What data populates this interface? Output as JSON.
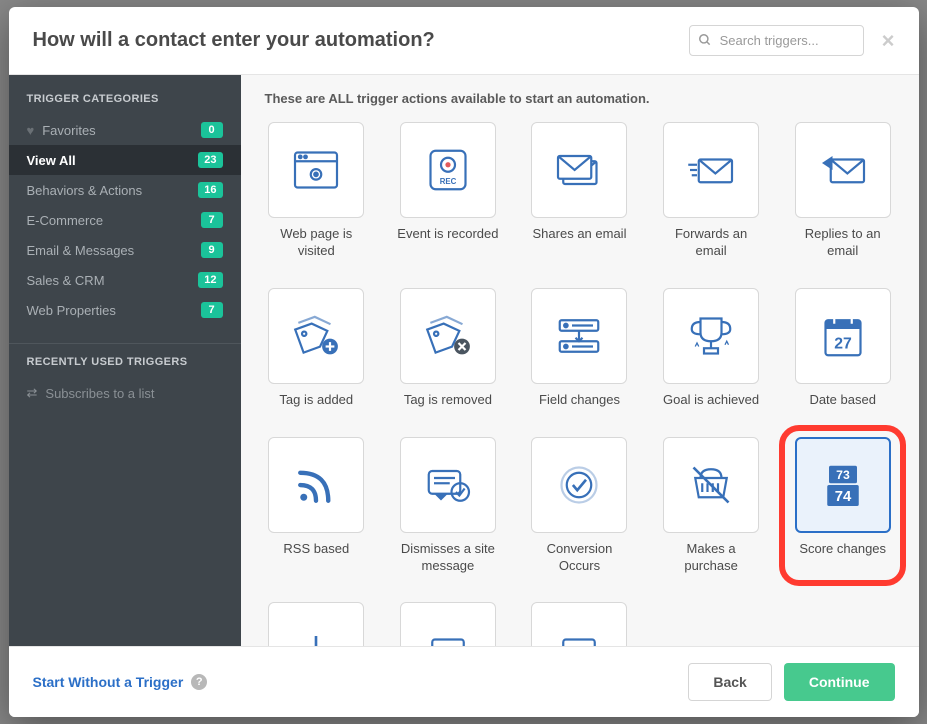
{
  "header": {
    "title": "How will a contact enter your automation?",
    "search_placeholder": "Search triggers...",
    "close": "×"
  },
  "sidebar": {
    "heading_categories": "TRIGGER CATEGORIES",
    "heading_recent": "RECENTLY USED TRIGGERS",
    "items": [
      {
        "label": "Favorites",
        "count": "0",
        "icon": "heart"
      },
      {
        "label": "View All",
        "count": "23",
        "active": true
      },
      {
        "label": "Behaviors & Actions",
        "count": "16"
      },
      {
        "label": "E-Commerce",
        "count": "7"
      },
      {
        "label": "Email & Messages",
        "count": "9"
      },
      {
        "label": "Sales & CRM",
        "count": "12"
      },
      {
        "label": "Web Properties",
        "count": "7"
      }
    ],
    "recent": [
      {
        "label": "Subscribes to a list"
      }
    ]
  },
  "main": {
    "description": "These are ALL trigger actions available to start an automation.",
    "triggers": [
      {
        "label": "Web page is visited",
        "icon": "webpage"
      },
      {
        "label": "Event is recorded",
        "icon": "record"
      },
      {
        "label": "Shares an email",
        "icon": "share-email"
      },
      {
        "label": "Forwards an email",
        "icon": "forward-email"
      },
      {
        "label": "Replies to an email",
        "icon": "reply-email"
      },
      {
        "label": "Tag is added",
        "icon": "tag-add"
      },
      {
        "label": "Tag is removed",
        "icon": "tag-remove"
      },
      {
        "label": "Field changes",
        "icon": "field"
      },
      {
        "label": "Goal is achieved",
        "icon": "trophy"
      },
      {
        "label": "Date based",
        "icon": "calendar"
      },
      {
        "label": "RSS based",
        "icon": "rss"
      },
      {
        "label": "Dismisses a site message",
        "icon": "dismiss"
      },
      {
        "label": "Conversion Occurs",
        "icon": "conversion"
      },
      {
        "label": "Makes a purchase",
        "icon": "purchase"
      },
      {
        "label": "Score changes",
        "icon": "score",
        "highlighted": true,
        "selected": true
      }
    ]
  },
  "footer": {
    "start_without": "Start Without a Trigger",
    "back": "Back",
    "continue": "Continue"
  },
  "icons": {
    "calendar_day": "27",
    "score_top": "73",
    "score_bottom": "74",
    "rec_label": "REC"
  }
}
